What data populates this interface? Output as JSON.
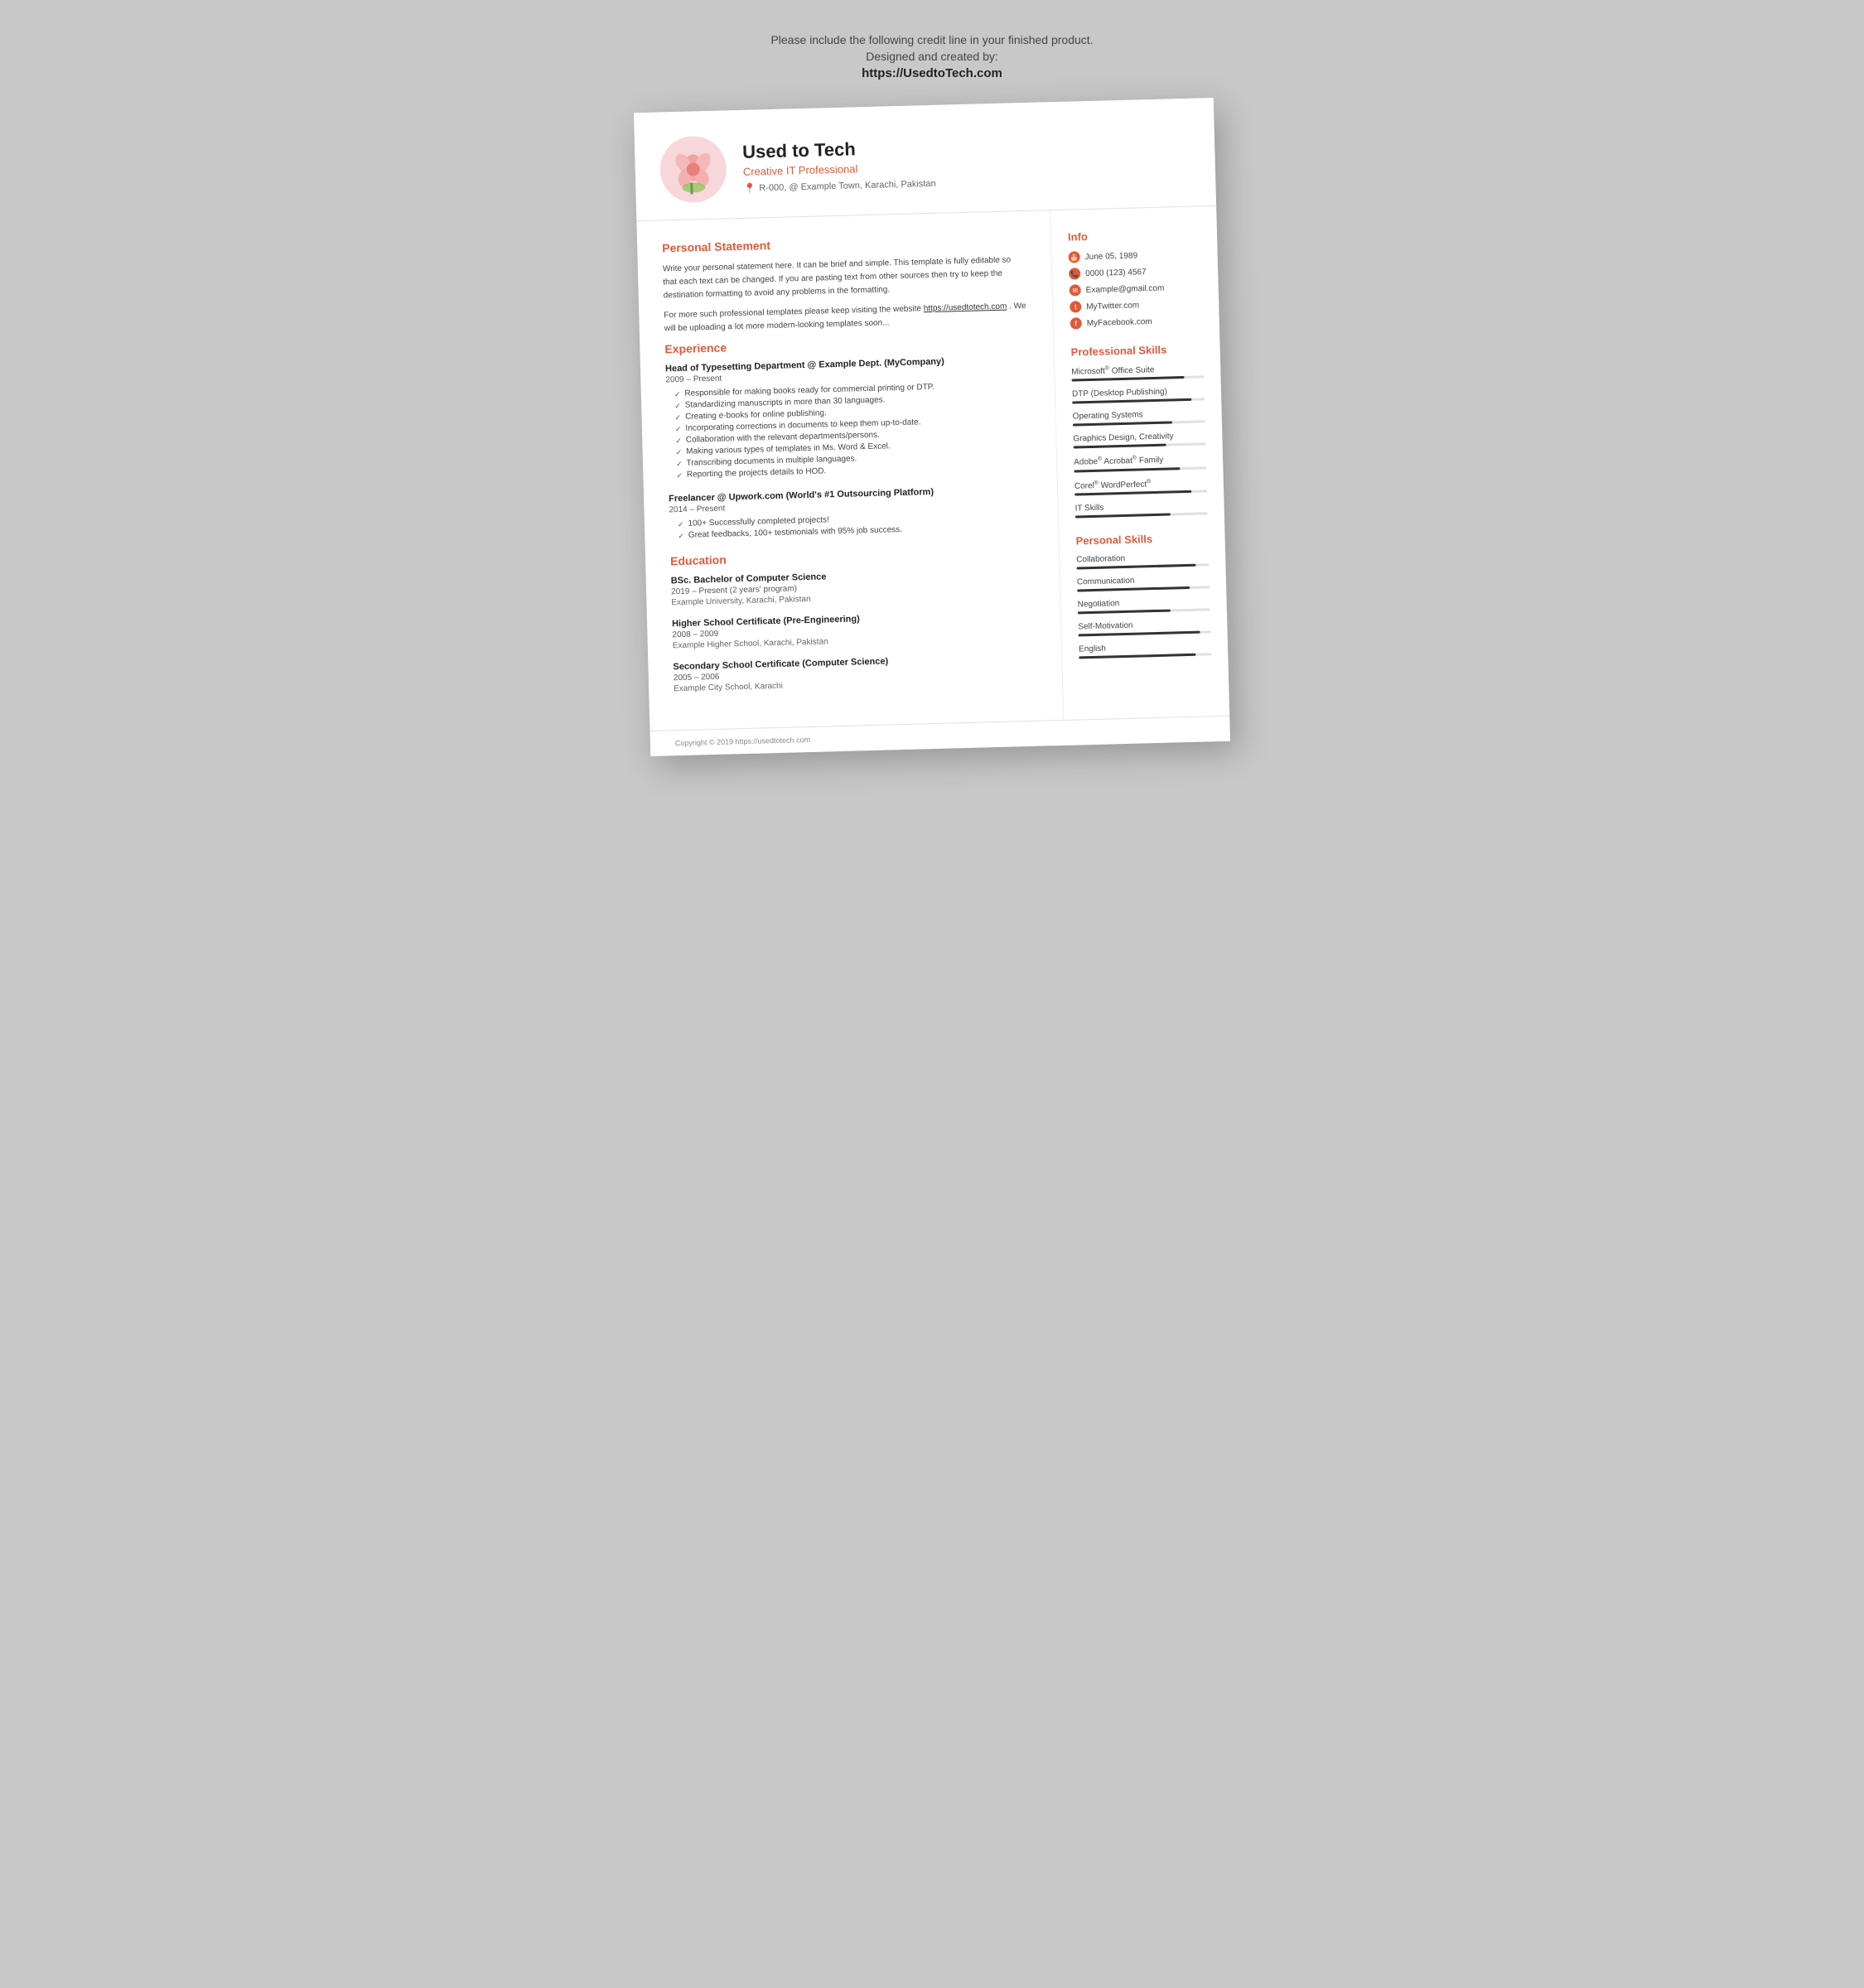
{
  "credit": {
    "line1": "Please include the following credit line in your finished product.",
    "line2": "Designed and created by:",
    "link": "https://UsedtoTech.com"
  },
  "header": {
    "name": "Used to Tech",
    "subtitle": "Creative IT Professional",
    "address": "R-000, @ Example Town, Karachi, Pakistan"
  },
  "personal_statement": {
    "title": "Personal Statement",
    "para1": "Write your personal statement here. It can be brief and simple. This template is fully editable so that each text can be changed. If you are pasting text from other sources then try to keep the destination formatting to avoid any problems in the formatting.",
    "para2": "For more such professional templates please keep visiting the website https://usedtotech.com. We will be uploading a lot more modern-looking templates soon..."
  },
  "experience": {
    "title": "Experience",
    "items": [
      {
        "title": "Head of Typesetting Department @ Example Dept. (MyCompany)",
        "date": "2009 – Present",
        "bullets": [
          "Responsible for making books ready for commercial printing or DTP.",
          "Standardizing manuscripts in more than 30 languages.",
          "Creating e-books for online publishing.",
          "Incorporating corrections in documents to keep them up-to-date.",
          "Collaboration with the relevant departments/persons.",
          "Making various types of templates in Ms. Word & Excel.",
          "Transcribing documents in multiple languages.",
          "Reporting the projects details to HOD."
        ]
      },
      {
        "title": "Freelancer @ Upwork.com (World's #1 Outsourcing Platform)",
        "date": "2014 – Present",
        "bullets": [
          "100+ Successfully completed projects!",
          "Great feedbacks, 100+ testimonials with 95% job success."
        ]
      }
    ]
  },
  "education": {
    "title": "Education",
    "items": [
      {
        "title": "BSc. Bachelor of Computer Science",
        "date": "2019 – Present (2 years' program)",
        "place": "Example University, Karachi, Pakistan"
      },
      {
        "title": "Higher School Certificate (Pre-Engineering)",
        "date": "2008 – 2009",
        "place": "Example Higher School, Karachi, Pakistan"
      },
      {
        "title": "Secondary School Certificate (Computer Science)",
        "date": "2005 – 2006",
        "place": "Example City School, Karachi"
      }
    ]
  },
  "info": {
    "title": "Info",
    "items": [
      {
        "icon": "🎂",
        "text": "June 05, 1989"
      },
      {
        "icon": "📞",
        "text": "0000 (123) 4567"
      },
      {
        "icon": "✉",
        "text": "Example@gmail.com"
      },
      {
        "icon": "🐦",
        "text": "MyTwitter.com"
      },
      {
        "icon": "f",
        "text": "MyFacebook.com"
      }
    ]
  },
  "professional_skills": {
    "title": "Professional Skills",
    "items": [
      {
        "label": "Microsoft® Office Suite",
        "percent": 85
      },
      {
        "label": "DTP (Desktop Publishing)",
        "percent": 90
      },
      {
        "label": "Operating Systems",
        "percent": 75
      },
      {
        "label": "Graphics Design, Creativity",
        "percent": 70
      },
      {
        "label": "Adobe® Acrobat® Family",
        "percent": 80
      },
      {
        "label": "Corel® WordPerfect®",
        "percent": 88
      },
      {
        "label": "IT Skills",
        "percent": 72
      }
    ]
  },
  "personal_skills": {
    "title": "Personal Skills",
    "items": [
      {
        "label": "Collaboration",
        "percent": 90
      },
      {
        "label": "Communication",
        "percent": 85
      },
      {
        "label": "Negotiation",
        "percent": 70
      },
      {
        "label": "Self-Motivation",
        "percent": 92
      },
      {
        "label": "English",
        "percent": 88
      }
    ]
  },
  "footer": {
    "text": "Copyright © 2019 https://usedtotech.com"
  }
}
